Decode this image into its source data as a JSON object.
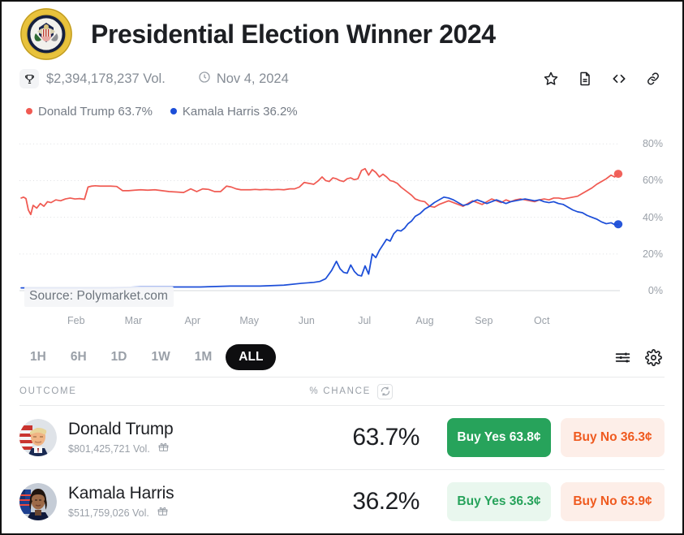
{
  "header": {
    "logo_icon": "presidential-seal-icon",
    "title": "Presidential Election Winner 2024"
  },
  "meta": {
    "volume_icon": "trophy-icon",
    "volume": "$2,394,178,237 Vol.",
    "date_icon": "clock-icon",
    "date": "Nov 4, 2024",
    "actions": [
      {
        "icon": "star-icon",
        "label": "Bookmark"
      },
      {
        "icon": "document-icon",
        "label": "Rules"
      },
      {
        "icon": "code-icon",
        "label": "Embed"
      },
      {
        "icon": "link-icon",
        "label": "Copy link"
      }
    ]
  },
  "legend": [
    {
      "label": "Donald Trump 63.7%",
      "color": "#f05a52"
    },
    {
      "label": "Kamala Harris 36.2%",
      "color": "#1c4ed8"
    }
  ],
  "chart_data": {
    "type": "line",
    "title": "Presidential Election Winner 2024",
    "xlabel": "",
    "ylabel": "% Chance",
    "ylim": [
      0,
      85
    ],
    "yticks": [
      0,
      20,
      40,
      60,
      80
    ],
    "ytick_labels": [
      "0%",
      "20%",
      "40%",
      "60%",
      "80%"
    ],
    "grid": true,
    "legend_position": "top-left",
    "watermark": "Source: Polymarket.com",
    "xtick_labels": [
      "Feb",
      "Mar",
      "Apr",
      "May",
      "Jun",
      "Jul",
      "Aug",
      "Sep",
      "Oct"
    ],
    "xtick_positions": [
      0.092,
      0.188,
      0.287,
      0.382,
      0.478,
      0.575,
      0.676,
      0.775,
      0.872
    ],
    "series": [
      {
        "name": "Donald Trump",
        "color": "#f05a52",
        "end_value": 63.7,
        "x": [
          0.0,
          0.004,
          0.008,
          0.012,
          0.016,
          0.02,
          0.026,
          0.032,
          0.038,
          0.044,
          0.05,
          0.058,
          0.066,
          0.074,
          0.082,
          0.09,
          0.098,
          0.106,
          0.112,
          0.118,
          0.124,
          0.132,
          0.14,
          0.15,
          0.16,
          0.17,
          0.18,
          0.19,
          0.2,
          0.212,
          0.224,
          0.236,
          0.248,
          0.26,
          0.272,
          0.284,
          0.294,
          0.304,
          0.314,
          0.324,
          0.334,
          0.344,
          0.352,
          0.36,
          0.368,
          0.376,
          0.384,
          0.392,
          0.4,
          0.41,
          0.42,
          0.43,
          0.44,
          0.45,
          0.458,
          0.466,
          0.474,
          0.482,
          0.49,
          0.498,
          0.504,
          0.51,
          0.516,
          0.522,
          0.528,
          0.534,
          0.54,
          0.546,
          0.552,
          0.558,
          0.564,
          0.57,
          0.576,
          0.582,
          0.588,
          0.594,
          0.6,
          0.606,
          0.612,
          0.618,
          0.624,
          0.63,
          0.636,
          0.642,
          0.648,
          0.654,
          0.66,
          0.668,
          0.676,
          0.684,
          0.692,
          0.7,
          0.708,
          0.716,
          0.724,
          0.732,
          0.74,
          0.748,
          0.756,
          0.764,
          0.772,
          0.78,
          0.788,
          0.796,
          0.804,
          0.812,
          0.82,
          0.828,
          0.836,
          0.844,
          0.852,
          0.86,
          0.868,
          0.876,
          0.884,
          0.892,
          0.9,
          0.908,
          0.916,
          0.924,
          0.932,
          0.94,
          0.948,
          0.956,
          0.964,
          0.972,
          0.98,
          0.988,
          0.994,
          1.0
        ],
        "values": [
          50.5,
          51.0,
          50.2,
          44.0,
          41.5,
          46.5,
          45.0,
          47.5,
          46.0,
          48.5,
          48.0,
          49.5,
          49.0,
          50.0,
          50.5,
          50.0,
          50.2,
          49.8,
          56.5,
          57.0,
          57.2,
          57.0,
          57.0,
          57.0,
          56.8,
          54.5,
          54.5,
          54.8,
          55.0,
          54.8,
          55.0,
          54.5,
          54.0,
          53.8,
          53.5,
          55.5,
          54.0,
          55.5,
          55.2,
          54.0,
          54.0,
          57.0,
          56.5,
          55.5,
          55.0,
          55.0,
          55.0,
          55.2,
          55.0,
          55.2,
          55.0,
          55.2,
          55.0,
          55.5,
          55.5,
          56.5,
          59.0,
          58.5,
          58.0,
          60.0,
          62.0,
          60.0,
          59.5,
          61.5,
          61.0,
          60.0,
          59.5,
          61.0,
          61.5,
          60.5,
          61.0,
          65.5,
          66.5,
          63.0,
          66.0,
          64.5,
          62.0,
          63.5,
          62.0,
          60.0,
          59.5,
          58.5,
          56.5,
          55.0,
          53.5,
          52.0,
          50.0,
          49.0,
          48.5,
          46.0,
          45.5,
          47.0,
          48.0,
          49.0,
          48.0,
          47.0,
          46.0,
          47.5,
          49.0,
          48.0,
          47.0,
          48.5,
          50.0,
          49.0,
          48.0,
          49.5,
          48.5,
          49.5,
          50.0,
          49.5,
          49.0,
          48.5,
          49.5,
          50.0,
          49.5,
          50.5,
          50.5,
          50.0,
          50.5,
          51.0,
          51.5,
          53.0,
          54.5,
          56.0,
          58.0,
          59.5,
          61.0,
          63.0,
          62.0,
          63.7
        ]
      },
      {
        "name": "Kamala Harris",
        "color": "#1c4ed8",
        "end_value": 36.2,
        "x": [
          0.0,
          0.05,
          0.1,
          0.15,
          0.2,
          0.25,
          0.3,
          0.35,
          0.4,
          0.44,
          0.47,
          0.49,
          0.5,
          0.51,
          0.52,
          0.528,
          0.534,
          0.54,
          0.546,
          0.552,
          0.558,
          0.564,
          0.57,
          0.576,
          0.582,
          0.588,
          0.594,
          0.6,
          0.606,
          0.612,
          0.618,
          0.624,
          0.63,
          0.636,
          0.642,
          0.648,
          0.654,
          0.66,
          0.668,
          0.676,
          0.684,
          0.692,
          0.7,
          0.708,
          0.716,
          0.724,
          0.732,
          0.74,
          0.748,
          0.756,
          0.764,
          0.772,
          0.78,
          0.788,
          0.796,
          0.804,
          0.812,
          0.82,
          0.828,
          0.836,
          0.844,
          0.852,
          0.86,
          0.868,
          0.876,
          0.884,
          0.892,
          0.9,
          0.908,
          0.916,
          0.924,
          0.932,
          0.94,
          0.948,
          0.956,
          0.964,
          0.972,
          0.98,
          0.988,
          0.994,
          1.0
        ],
        "values": [
          1.5,
          1.5,
          1.5,
          1.5,
          2.0,
          2.0,
          2.0,
          2.5,
          2.5,
          3.0,
          4.0,
          4.5,
          5.0,
          6.5,
          11.0,
          16.0,
          12.0,
          10.0,
          9.5,
          14.0,
          10.5,
          8.5,
          8.0,
          13.5,
          9.0,
          20.0,
          18.0,
          22.0,
          25.0,
          28.0,
          27.0,
          31.0,
          33.0,
          32.5,
          34.0,
          36.5,
          38.0,
          40.5,
          42.0,
          44.5,
          46.0,
          48.0,
          49.5,
          51.0,
          50.5,
          49.5,
          48.0,
          46.5,
          47.0,
          48.5,
          49.5,
          48.5,
          47.5,
          48.5,
          49.5,
          48.5,
          47.5,
          48.5,
          49.0,
          49.5,
          50.0,
          49.5,
          49.0,
          49.5,
          48.5,
          48.0,
          48.5,
          47.5,
          47.0,
          45.5,
          44.0,
          43.0,
          42.5,
          41.0,
          40.0,
          39.0,
          37.5,
          36.5,
          37.0,
          36.0,
          36.2
        ]
      }
    ]
  },
  "time_ranges": [
    {
      "label": "1H",
      "active": false
    },
    {
      "label": "6H",
      "active": false
    },
    {
      "label": "1D",
      "active": false
    },
    {
      "label": "1W",
      "active": false
    },
    {
      "label": "1M",
      "active": false
    },
    {
      "label": "ALL",
      "active": true
    }
  ],
  "chart_controls": [
    {
      "icon": "sliders-icon",
      "label": "Chart settings"
    },
    {
      "icon": "gear-icon",
      "label": "Settings"
    }
  ],
  "table": {
    "col_outcome": "OUTCOME",
    "col_chance": "% CHANCE",
    "refresh_icon": "refresh-icon",
    "rows": [
      {
        "avatar_icon": "donald-trump-avatar",
        "name": "Donald Trump",
        "volume": "$801,425,721 Vol.",
        "gift_icon": "gift-icon",
        "chance": "63.7%",
        "buy_yes": "Buy Yes 63.8¢",
        "buy_no": "Buy No 36.3¢",
        "yes_style": "solid"
      },
      {
        "avatar_icon": "kamala-harris-avatar",
        "name": "Kamala Harris",
        "volume": "$511,759,026 Vol.",
        "gift_icon": "gift-icon",
        "chance": "36.2%",
        "buy_yes": "Buy Yes 36.3¢",
        "buy_no": "Buy No 63.9¢",
        "yes_style": "soft"
      }
    ]
  },
  "colors": {
    "trump": "#f05a52",
    "harris": "#1c4ed8",
    "yes_green": "#27a35b",
    "no_orange": "#ef5a1f",
    "active_pill": "#0e0e10"
  }
}
